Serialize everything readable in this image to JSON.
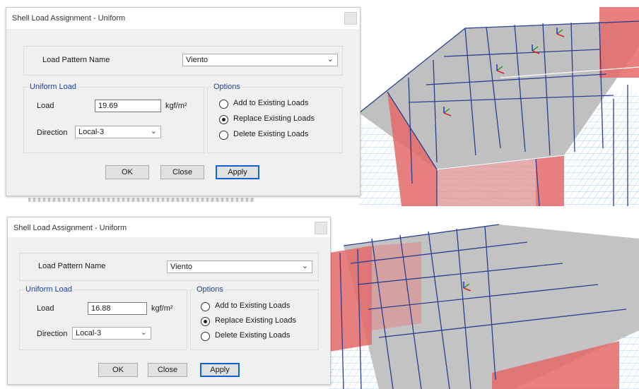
{
  "dialogs": [
    {
      "title": "Shell Load Assignment - Uniform",
      "load_pattern_label": "Load Pattern Name",
      "load_pattern_value": "Viento",
      "uniform_load_group": "Uniform Load",
      "load_label": "Load",
      "load_value": "19.69",
      "load_unit": "kgf/m²",
      "direction_label": "Direction",
      "direction_value": "Local-3",
      "options_group": "Options",
      "options": [
        {
          "label": "Add to Existing Loads",
          "selected": false
        },
        {
          "label": "Replace Existing Loads",
          "selected": true
        },
        {
          "label": "Delete Existing Loads",
          "selected": false
        }
      ],
      "ok_label": "OK",
      "close_label": "Close",
      "apply_label": "Apply"
    },
    {
      "title": "Shell Load Assignment - Uniform",
      "load_pattern_label": "Load Pattern Name",
      "load_pattern_value": "Viento",
      "uniform_load_group": "Uniform Load",
      "load_label": "Load",
      "load_value": "16.88",
      "load_unit": "kgf/m²",
      "direction_label": "Direction",
      "direction_value": "Local-3",
      "options_group": "Options",
      "options": [
        {
          "label": "Add to Existing Loads",
          "selected": false
        },
        {
          "label": "Replace Existing Loads",
          "selected": true
        },
        {
          "label": "Delete Existing Loads",
          "selected": false
        }
      ],
      "ok_label": "OK",
      "close_label": "Close",
      "apply_label": "Apply"
    }
  ],
  "icons": {
    "combo_chevron": "chevron-down-icon",
    "window_close": "close-icon"
  },
  "colors": {
    "roof_gray": "#bdbdbd",
    "wall_red": "#e46a6a",
    "frame_blue": "#2c3f8f",
    "grid_blue": "#a9c7ea",
    "group_title_blue": "#1f3f9f"
  }
}
